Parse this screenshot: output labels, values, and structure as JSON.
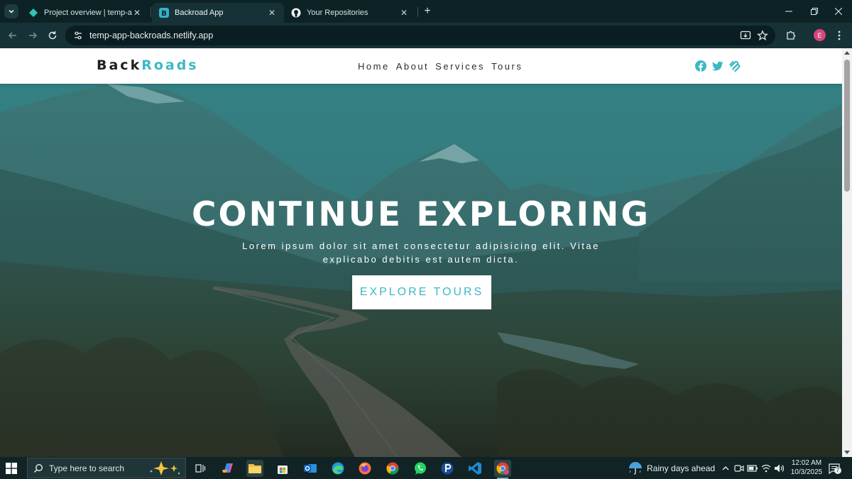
{
  "browser": {
    "tabs": [
      {
        "title": "Project overview | temp-app-ba",
        "active": false,
        "icon": "netlify-diamond-icon"
      },
      {
        "title": "Backroad App",
        "active": true,
        "icon": "bootstrap-b-icon"
      },
      {
        "title": "Your Repositories",
        "active": false,
        "icon": "github-icon"
      }
    ],
    "url": "temp-app-backroads.netlify.app",
    "profile_initial": "E"
  },
  "site": {
    "logo_part1": "Back",
    "logo_part2": "Roads",
    "nav_links": [
      "Home",
      "About",
      "Services",
      "Tours"
    ],
    "social_icons": [
      "facebook-icon",
      "twitter-icon",
      "squarespace-icon"
    ],
    "accent_color": "#3cb8c4",
    "hero": {
      "title": "CONTINUE EXPLORING",
      "text": "Lorem ipsum dolor sit amet consectetur adipisicing elit. Vitae explicabo debitis est autem dicta.",
      "button": "EXPLORE TOURS"
    }
  },
  "taskbar": {
    "search_placeholder": "Type here to search",
    "weather": "Rainy days ahead",
    "time": "12:02 AM",
    "date": "10/3/2025",
    "notification_count": "7"
  }
}
